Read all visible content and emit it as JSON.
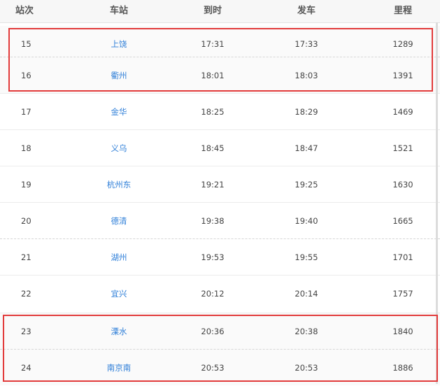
{
  "columns": {
    "seq": "站次",
    "station": "车站",
    "arrive": "到时",
    "depart": "发车",
    "distance": "里程"
  },
  "rows": [
    {
      "seq": "15",
      "station": "上饶",
      "arrive": "17:31",
      "depart": "17:33",
      "distance": "1289"
    },
    {
      "seq": "16",
      "station": "衢州",
      "arrive": "18:01",
      "depart": "18:03",
      "distance": "1391"
    },
    {
      "seq": "17",
      "station": "金华",
      "arrive": "18:25",
      "depart": "18:29",
      "distance": "1469"
    },
    {
      "seq": "18",
      "station": "义乌",
      "arrive": "18:45",
      "depart": "18:47",
      "distance": "1521"
    },
    {
      "seq": "19",
      "station": "杭州东",
      "arrive": "19:21",
      "depart": "19:25",
      "distance": "1630"
    },
    {
      "seq": "20",
      "station": "德清",
      "arrive": "19:38",
      "depart": "19:40",
      "distance": "1665"
    },
    {
      "seq": "21",
      "station": "湖州",
      "arrive": "19:53",
      "depart": "19:55",
      "distance": "1701"
    },
    {
      "seq": "22",
      "station": "宜兴",
      "arrive": "20:12",
      "depart": "20:14",
      "distance": "1757"
    },
    {
      "seq": "23",
      "station": "溧水",
      "arrive": "20:36",
      "depart": "20:38",
      "distance": "1840"
    },
    {
      "seq": "24",
      "station": "南京南",
      "arrive": "20:53",
      "depart": "20:53",
      "distance": "1886"
    }
  ],
  "colors": {
    "link": "#2f7fd8",
    "highlight": "#e23b3b",
    "header_bg": "#f7f7f7"
  }
}
